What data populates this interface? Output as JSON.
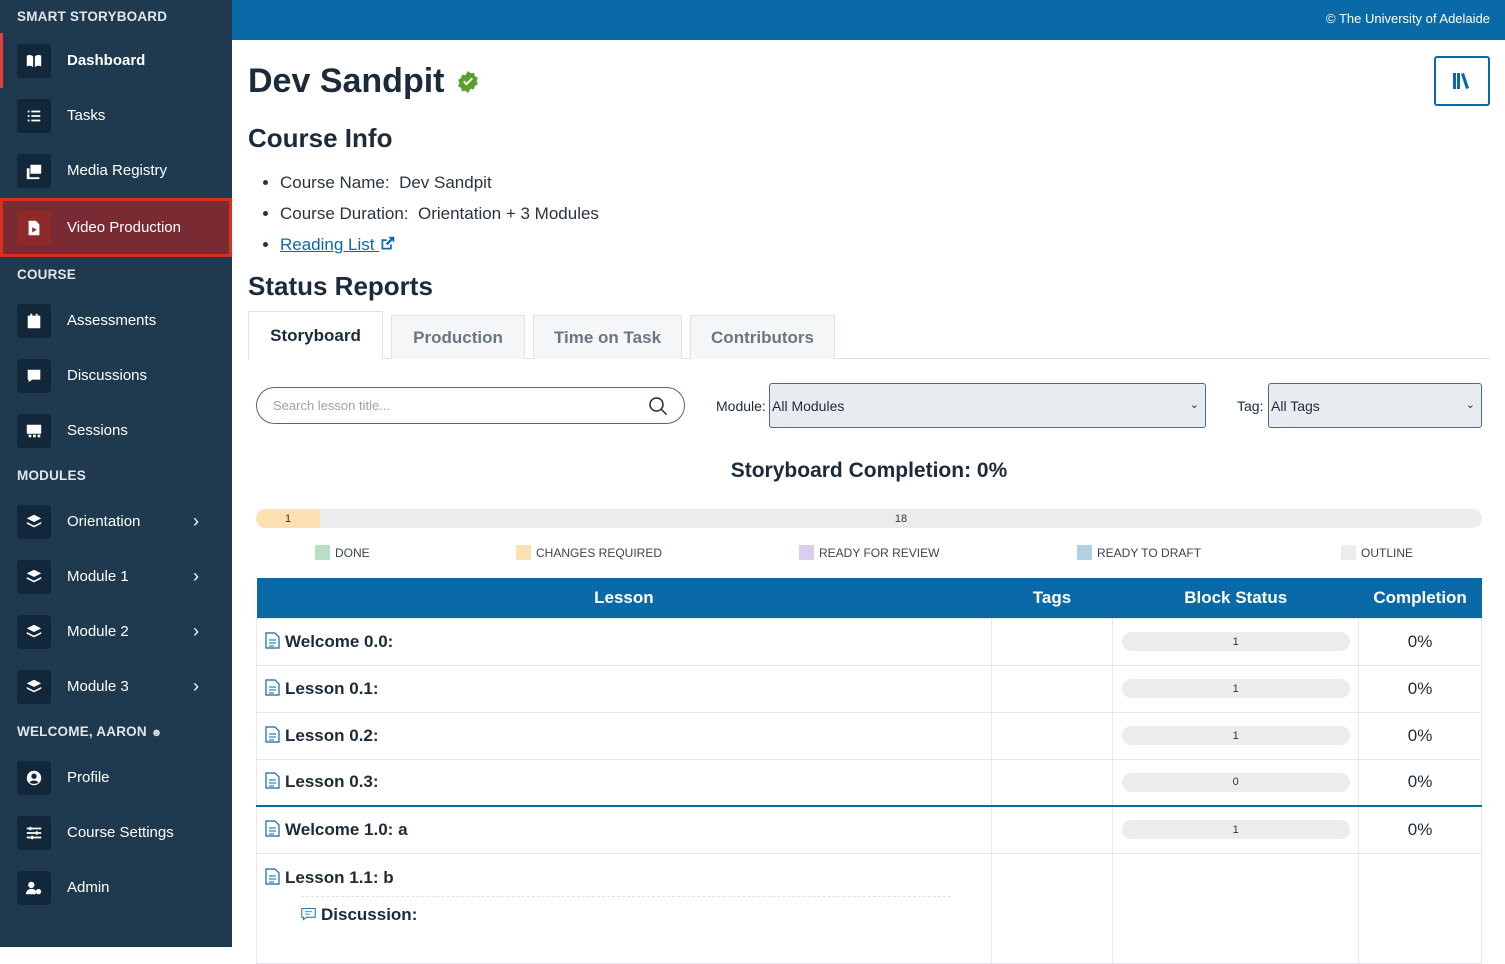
{
  "sidebar": {
    "brand": "SMART STORYBOARD",
    "main_items": [
      {
        "label": "Dashboard",
        "icon": "book-icon"
      },
      {
        "label": "Tasks",
        "icon": "task-list-icon"
      },
      {
        "label": "Media Registry",
        "icon": "media-icon"
      },
      {
        "label": "Video Production",
        "icon": "video-file-icon"
      }
    ],
    "course_section": "COURSE",
    "course_items": [
      {
        "label": "Assessments",
        "icon": "calendar-check-icon"
      },
      {
        "label": "Discussions",
        "icon": "chat-icon"
      },
      {
        "label": "Sessions",
        "icon": "presentation-icon"
      }
    ],
    "modules_section": "MODULES",
    "module_items": [
      {
        "label": "Orientation",
        "icon": "layers-icon"
      },
      {
        "label": "Module 1",
        "icon": "layers-icon"
      },
      {
        "label": "Module 2",
        "icon": "layers-icon"
      },
      {
        "label": "Module 3",
        "icon": "layers-icon"
      }
    ],
    "welcome_section": "WELCOME, AARON",
    "user_items": [
      {
        "label": "Profile",
        "icon": "user-circle-icon"
      },
      {
        "label": "Course Settings",
        "icon": "sliders-icon"
      },
      {
        "label": "Admin",
        "icon": "user-gear-icon"
      }
    ]
  },
  "topbar": {
    "copyright": "© The University of Adelaide"
  },
  "page": {
    "title": "Dev Sandpit",
    "course_info_heading": "Course Info",
    "course_name_label": "Course Name:",
    "course_name": "Dev Sandpit",
    "course_duration_label": "Course Duration:",
    "course_duration": "Orientation + 3 Modules",
    "reading_list": "Reading List",
    "status_reports_heading": "Status Reports"
  },
  "tabs": [
    "Storyboard",
    "Production",
    "Time on Task",
    "Contributors"
  ],
  "filters": {
    "search_placeholder": "Search lesson title...",
    "module_label": "Module:",
    "module_value": "All Modules",
    "tag_label": "Tag:",
    "tag_value": "All Tags"
  },
  "completion": {
    "title": "Storyboard Completion: 0%",
    "changes_required_count": "1",
    "outline_count": "18",
    "changes_required_fraction": 0.0526
  },
  "legend": [
    {
      "label": "DONE",
      "color": "#b7dfc4"
    },
    {
      "label": "CHANGES REQUIRED",
      "color": "#fbe0b0"
    },
    {
      "label": "READY FOR REVIEW",
      "color": "#d9cdf0"
    },
    {
      "label": "READY TO DRAFT",
      "color": "#b3cfe3"
    },
    {
      "label": "OUTLINE",
      "color": "#ececec"
    }
  ],
  "table": {
    "headers": [
      "Lesson",
      "Tags",
      "Block Status",
      "Completion"
    ],
    "rows": [
      {
        "lesson": "Welcome 0.0:",
        "block": "1",
        "completion": "0%"
      },
      {
        "lesson": "Lesson 0.1:",
        "block": "1",
        "completion": "0%"
      },
      {
        "lesson": "Lesson 0.2:",
        "block": "1",
        "completion": "0%"
      },
      {
        "lesson": "Lesson 0.3:",
        "block": "0",
        "completion": "0%"
      },
      {
        "lesson": "Welcome 1.0: a",
        "block": "1",
        "completion": "0%"
      },
      {
        "lesson": "Lesson 1.1: b",
        "sub": "Discussion:"
      }
    ]
  }
}
